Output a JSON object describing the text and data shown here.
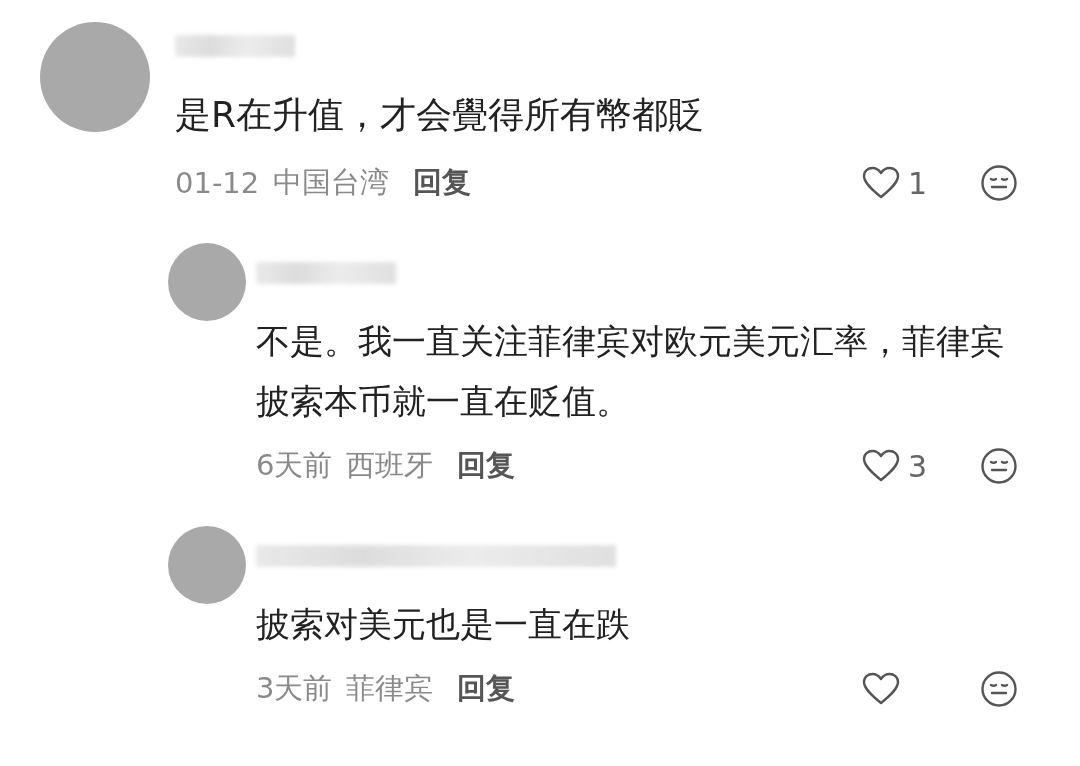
{
  "comments": [
    {
      "text": "是R在升值，才会覺得所有幣都貶",
      "date": "01-12",
      "location": "中国台湾",
      "reply_label": "回复",
      "likes": "1",
      "liked": false,
      "replies": [
        {
          "text": "不是。我一直关注菲律宾对欧元美元汇率，菲律宾披索本币就一直在贬值。",
          "date": "6天前",
          "location": "西班牙",
          "reply_label": "回复",
          "likes": "3",
          "liked": false
        },
        {
          "text": "披索对美元也是一直在跌",
          "date": "3天前",
          "location": "菲律宾",
          "reply_label": "回复",
          "liked": false
        }
      ]
    }
  ]
}
